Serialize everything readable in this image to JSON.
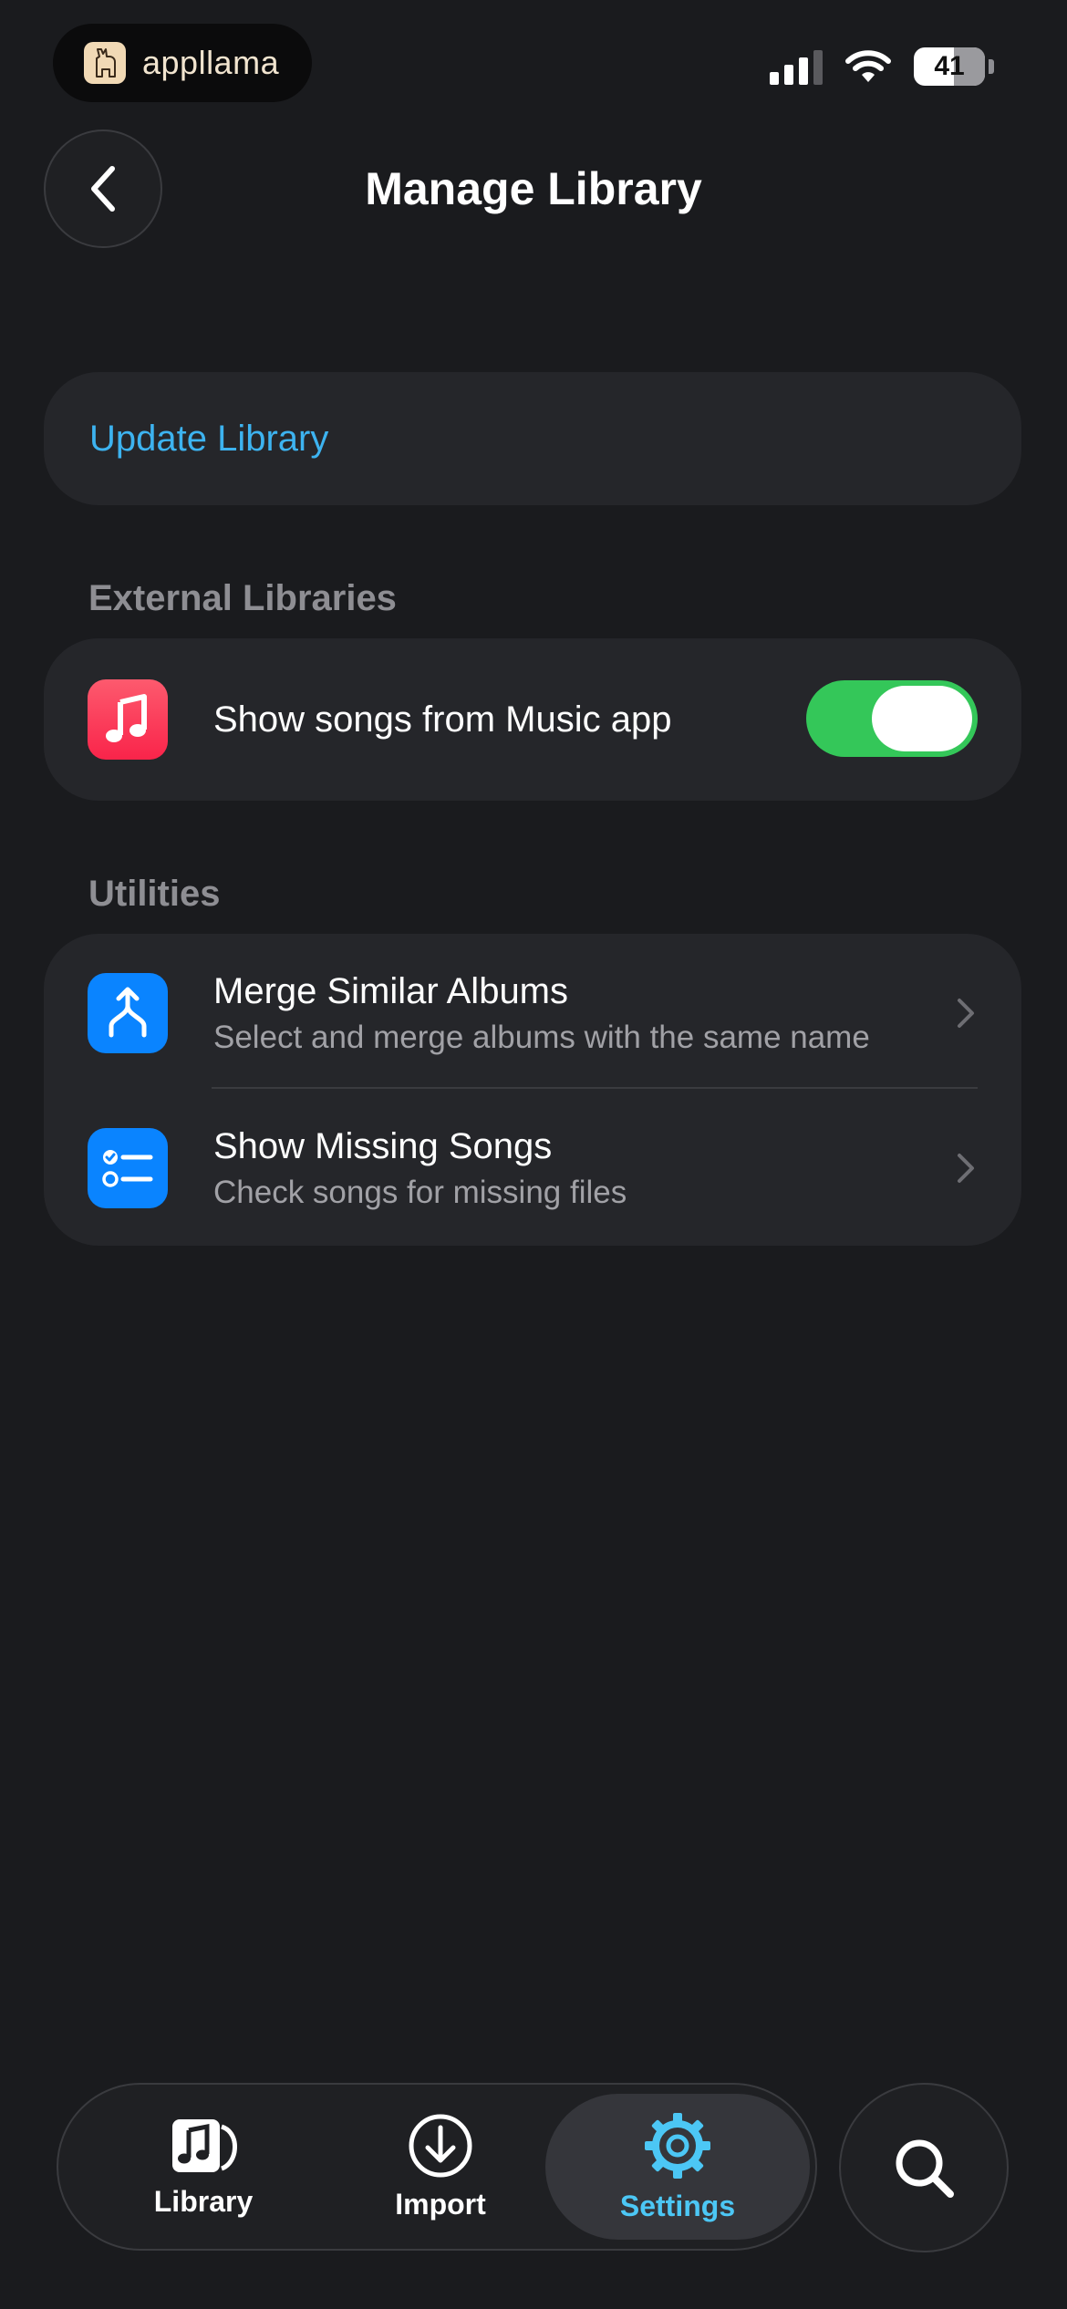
{
  "status_bar": {
    "brand_name": "appllama",
    "battery_level": "41"
  },
  "header": {
    "title": "Manage Library"
  },
  "update": {
    "label": "Update Library"
  },
  "external": {
    "section_label": "External Libraries",
    "music_toggle_label": "Show songs from Music app",
    "music_toggle_on": true
  },
  "utilities": {
    "section_label": "Utilities",
    "items": [
      {
        "title": "Merge Similar Albums",
        "subtitle": "Select and merge albums with the same name",
        "icon": "merge-icon"
      },
      {
        "title": "Show Missing Songs",
        "subtitle": "Check songs for missing files",
        "icon": "checklist-icon"
      }
    ]
  },
  "tabbar": {
    "tabs": [
      {
        "label": "Library",
        "icon": "music-doc-icon",
        "active": false
      },
      {
        "label": "Import",
        "icon": "download-circle-icon",
        "active": false
      },
      {
        "label": "Settings",
        "icon": "gear-icon",
        "active": true
      }
    ],
    "search_icon": "search-icon"
  },
  "colors": {
    "background": "#1a1b1e",
    "card": "#25262a",
    "accent_link": "#3db3f0",
    "toggle_on": "#34c759",
    "music_icon": "#fc3c5a",
    "utility_icon": "#0a84ff",
    "active_tab": "#4cc7f5"
  }
}
